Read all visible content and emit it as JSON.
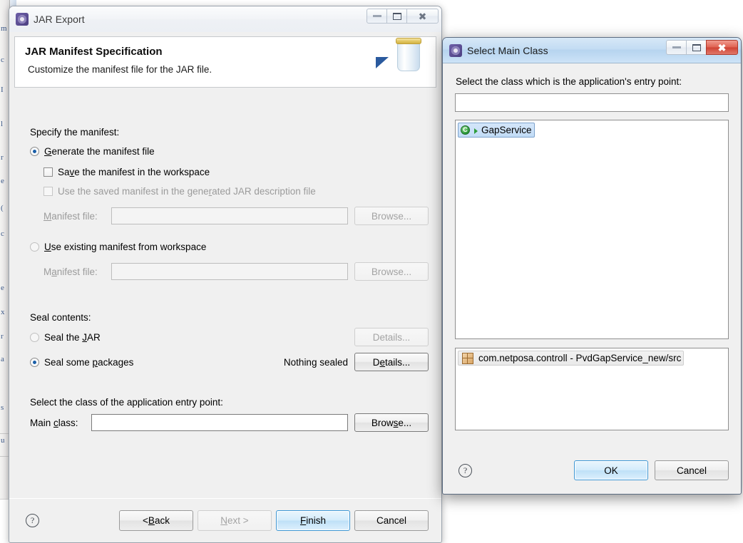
{
  "desktop": {
    "ide_glyphs": [
      "m",
      "c",
      "l",
      "I",
      "r",
      "e",
      "(",
      "c",
      "e",
      "x",
      "r",
      "a",
      "s",
      "u"
    ]
  },
  "jar_export": {
    "title": "JAR Export",
    "icon": "eclipse-wizard-icon",
    "window_buttons": {
      "minimize": "minimize-icon",
      "maximize": "restore-icon",
      "close": "close-icon"
    },
    "header": {
      "heading": "JAR Manifest Specification",
      "description": "Customize the manifest file for the JAR file.",
      "banner_icon": "jar-banner-icon"
    },
    "manifest_section": {
      "label": "Specify the manifest:",
      "generate": {
        "label_pre": "G",
        "label_mnemonic": "G",
        "label_rest": "enerate the manifest file",
        "full_label": "Generate the manifest file",
        "checked": true
      },
      "save_in_workspace": {
        "full_label": "Save the manifest in the workspace",
        "checked": false,
        "enabled": true
      },
      "use_saved": {
        "full_label": "Use the saved manifest in the generated JAR description file",
        "checked": false,
        "enabled": false
      },
      "manifest_file_label": "Manifest file:",
      "manifest_file_value": "",
      "browse_label": "Browse...",
      "use_existing": {
        "full_label": "Use existing manifest from workspace",
        "checked": false
      },
      "manifest_file_label2": "Manifest file:",
      "manifest_file_value2": "",
      "browse_label2": "Browse..."
    },
    "seal_section": {
      "label": "Seal contents:",
      "seal_jar": {
        "full_label": "Seal the JAR",
        "checked": false,
        "details_label": "Details...",
        "details_enabled": false
      },
      "seal_packages": {
        "full_label": "Seal some packages",
        "checked": true,
        "status": "Nothing sealed",
        "details_label": "Details...",
        "details_enabled": true
      }
    },
    "entry_point_section": {
      "label": "Select the class of the application entry point:",
      "main_class_label": "Main class:",
      "main_class_value": "",
      "browse_label": "Browse..."
    },
    "footer": {
      "help": "?",
      "back": "< Back",
      "next": "Next >",
      "finish": "Finish",
      "cancel": "Cancel",
      "next_enabled": false,
      "finish_default": true
    }
  },
  "select_main_class": {
    "title": "Select Main Class",
    "icon": "eclipse-wizard-icon",
    "window_buttons": {
      "minimize": "minimize-icon",
      "maximize": "restore-icon",
      "close": "close-icon"
    },
    "prompt": "Select the class which is the application's entry point:",
    "filter_value": "",
    "filter_placeholder": "",
    "matches": [
      {
        "name": "GapService",
        "icon": "java-class-icon",
        "runnable": true,
        "selected": true
      }
    ],
    "qualifier": [
      {
        "name": "com.netposa.controll - PvdGapService_new/src",
        "icon": "java-package-icon",
        "selected": true
      }
    ],
    "footer": {
      "help": "?",
      "ok": "OK",
      "cancel": "Cancel",
      "ok_default": true
    }
  },
  "colors": {
    "accent_blue": "#3c96d4",
    "selection_blue": "#c2dcf6",
    "close_red": "#cf4334",
    "class_green": "#2e9c3c",
    "package_tan": "#d9a767"
  }
}
